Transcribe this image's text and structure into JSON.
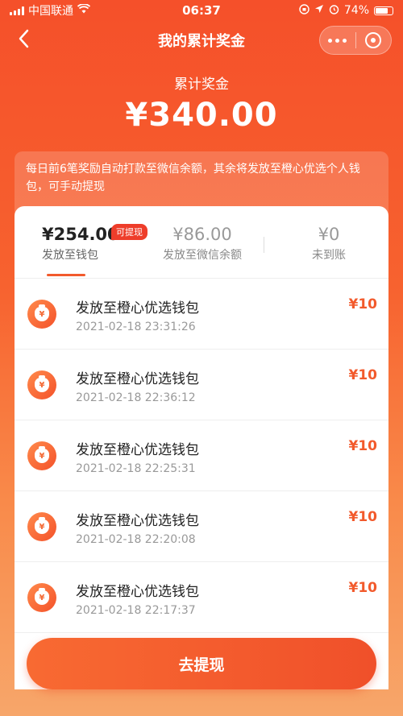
{
  "status_bar": {
    "carrier": "中国联通",
    "time": "06:37",
    "battery": "74%"
  },
  "nav": {
    "title": "我的累计奖金"
  },
  "hero": {
    "label": "累计奖金",
    "amount": "¥340.00"
  },
  "notice": {
    "text": "每日前6笔奖励自动打款至微信余额，其余将发放至橙心优选个人钱包，可手动提现"
  },
  "tabs": [
    {
      "amount": "¥254.00",
      "label": "发放至钱包",
      "badge": "可提现",
      "active": true
    },
    {
      "amount": "¥86.00",
      "label": "发放至微信余额",
      "active": false
    },
    {
      "amount": "¥0",
      "label": "未到账",
      "active": false
    }
  ],
  "records": [
    {
      "title": "发放至橙心优选钱包",
      "time": "2021-02-18 23:31:26",
      "amount": "¥10"
    },
    {
      "title": "发放至橙心优选钱包",
      "time": "2021-02-18 22:36:12",
      "amount": "¥10"
    },
    {
      "title": "发放至橙心优选钱包",
      "time": "2021-02-18 22:25:31",
      "amount": "¥10"
    },
    {
      "title": "发放至橙心优选钱包",
      "time": "2021-02-18 22:20:08",
      "amount": "¥10"
    },
    {
      "title": "发放至橙心优选钱包",
      "time": "2021-02-18 22:17:37",
      "amount": "¥10"
    }
  ],
  "cta": {
    "label": "去提现"
  },
  "colors": {
    "brand": "#f25a2c",
    "badge": "#ee3d2a"
  }
}
